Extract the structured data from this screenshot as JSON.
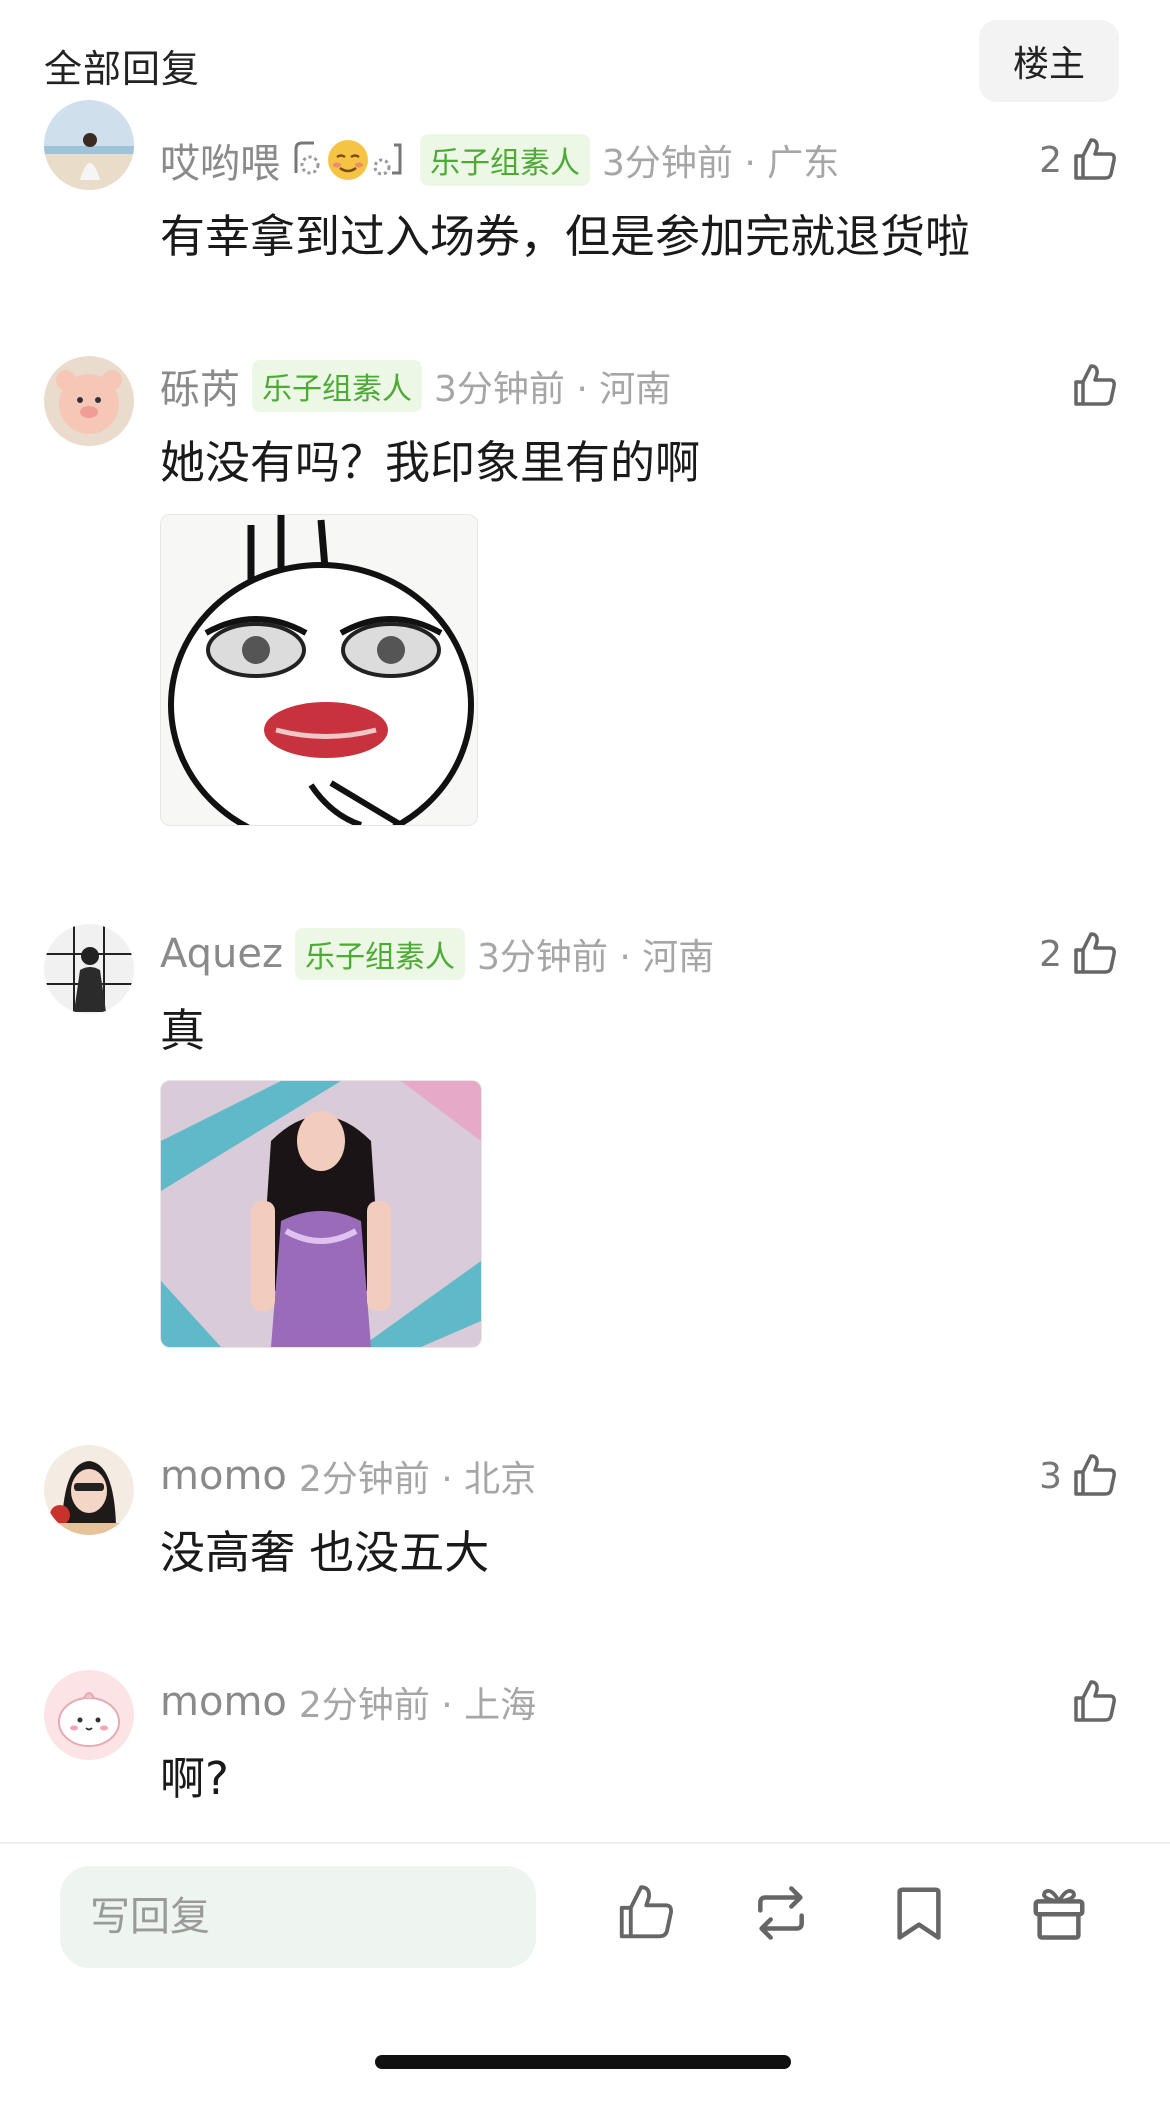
{
  "header": {
    "title": "全部回复",
    "owner_button": "楼主"
  },
  "colors": {
    "badge_bg": "#ecf7e6",
    "badge_text": "#4caa35",
    "meta_gray": "#a6a6a6",
    "input_bg": "#eef4ef"
  },
  "comments": [
    {
      "username": "哎哟喂",
      "badge": "乐子组素人",
      "time": "3分钟前 · 广东",
      "likes": "2",
      "text": "有幸拿到过入场券，但是参加完就退货啦",
      "has_deco": true
    },
    {
      "username": "砾芮",
      "badge": "乐子组素人",
      "time": "3分钟前 · 河南",
      "likes": "",
      "text": "她没有吗？我印象里有的啊",
      "image": "bunny-sticker"
    },
    {
      "username": "Aquez",
      "badge": "乐子组素人",
      "time": "3分钟前 · 河南",
      "likes": "2",
      "text": "真",
      "image": "girl-photo"
    },
    {
      "username": "momo",
      "badge": "",
      "time": "2分钟前 · 北京",
      "likes": "3",
      "text": "没高奢 也没五大"
    },
    {
      "username": "momo",
      "badge": "",
      "time": "2分钟前 · 上海",
      "likes": "",
      "text": "啊?"
    }
  ],
  "bottom_bar": {
    "reply_placeholder": "写回复",
    "icons": [
      "thumb-up-icon",
      "repost-icon",
      "bookmark-icon",
      "gift-icon"
    ]
  }
}
